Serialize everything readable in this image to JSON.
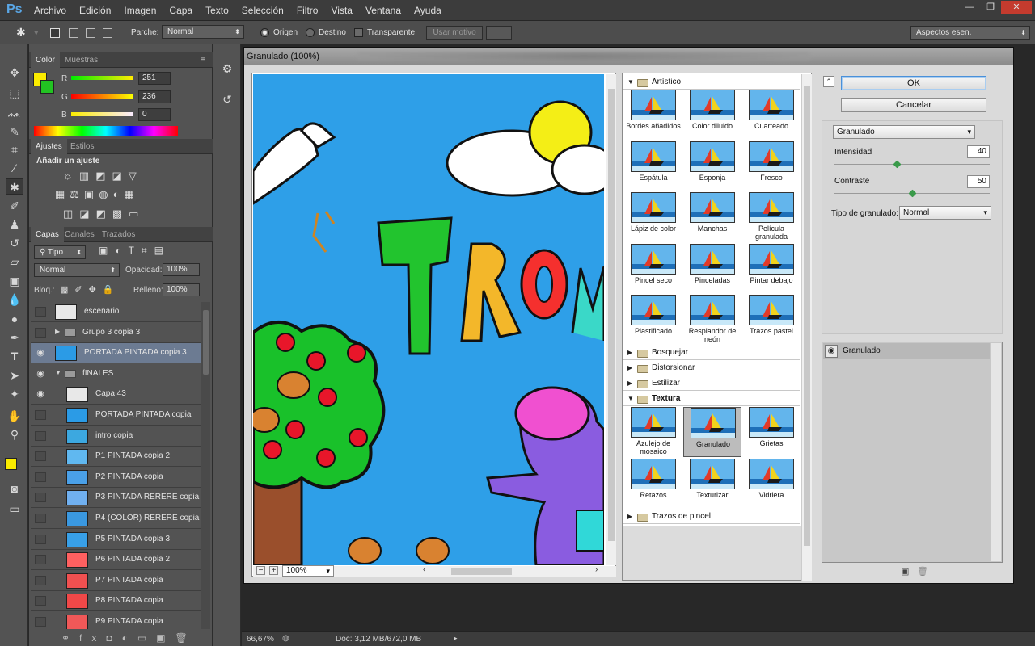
{
  "app": {
    "logo": "Ps"
  },
  "menu": [
    "Archivo",
    "Edición",
    "Imagen",
    "Capa",
    "Texto",
    "Selección",
    "Filtro",
    "Vista",
    "Ventana",
    "Ayuda"
  ],
  "window_controls": {
    "minimize": "—",
    "restore": "❐",
    "close": "✕"
  },
  "options": {
    "parche_label": "Parche:",
    "parche_value": "Normal",
    "origen": "Origen",
    "destino": "Destino",
    "transparente": "Transparente",
    "usar_motivo": "Usar motivo",
    "workspace": "Aspectos esen."
  },
  "color_panel": {
    "tabs": [
      "Color",
      "Muestras"
    ],
    "r_label": "R",
    "r_value": "251",
    "g_label": "G",
    "g_value": "236",
    "b_label": "B",
    "b_value": "0",
    "foreground": "#fbec00",
    "background": "#22c322"
  },
  "adjust_panel": {
    "tabs": [
      "Ajustes",
      "Estilos"
    ],
    "heading": "Añadir un ajuste"
  },
  "layers_panel": {
    "tabs": [
      "Capas",
      "Canales",
      "Trazados"
    ],
    "filter": "Tipo",
    "blend": "Normal",
    "opacity_label": "Opacidad:",
    "opacity": "100%",
    "lock_label": "Bloq.:",
    "fill_label": "Relleno:",
    "fill": "100%",
    "layers": [
      {
        "name": "escenario",
        "visible": false
      },
      {
        "name": "Grupo 3 copia 3",
        "visible": false,
        "group": true
      },
      {
        "name": "PORTADA PINTADA copia 3",
        "visible": true,
        "selected": true
      },
      {
        "name": "fINALES",
        "visible": true,
        "group": true,
        "open": true
      },
      {
        "name": "Capa 43",
        "visible": true
      },
      {
        "name": "PORTADA PINTADA copia",
        "visible": false
      },
      {
        "name": "intro copia",
        "visible": false
      },
      {
        "name": "P1 PINTADA copia 2",
        "visible": false
      },
      {
        "name": "P2 PINTADA copia",
        "visible": false
      },
      {
        "name": "P3 PINTADA RERERE copia",
        "visible": false
      },
      {
        "name": "P4 (COLOR) RERERE copia",
        "visible": false
      },
      {
        "name": "P5 PINTADA copia 3",
        "visible": false
      },
      {
        "name": "P6 PINTADA copia 2",
        "visible": false
      },
      {
        "name": "P7 PINTADA copia",
        "visible": false
      },
      {
        "name": "P8 PINTADA copia",
        "visible": false
      },
      {
        "name": "P9 PINTADA copia",
        "visible": false
      }
    ]
  },
  "status": {
    "zoom": "66,67%",
    "doc": "Doc: 3,12 MB/672,0 MB"
  },
  "dialog": {
    "title": "Granulado (100%)",
    "preview_zoom": "100%",
    "preview_text": "TROM",
    "categories": {
      "artistico": "Artístico",
      "bosquejar": "Bosquejar",
      "distorsionar": "Distorsionar",
      "estilizar": "Estilizar",
      "textura": "Textura",
      "trazos": "Trazos de pincel"
    },
    "artistic_filters": [
      "Bordes añadidos",
      "Color diluido",
      "Cuarteado",
      "Espátula",
      "Esponja",
      "Fresco",
      "Lápiz de color",
      "Manchas",
      "Película granulada",
      "Pincel seco",
      "Pinceladas",
      "Pintar debajo",
      "Plastificado",
      "Resplandor de neón",
      "Trazos pastel"
    ],
    "texture_filters": [
      "Azulejo de mosaico",
      "Granulado",
      "Grietas",
      "Retazos",
      "Texturizar",
      "Vidriera"
    ],
    "ok": "OK",
    "cancel": "Cancelar",
    "filter_select": "Granulado",
    "intensidad_label": "Intensidad",
    "intensidad": "40",
    "contraste_label": "Contraste",
    "contraste": "50",
    "tipo_label": "Tipo de granulado:",
    "tipo": "Normal",
    "effect_layer": "Granulado"
  }
}
